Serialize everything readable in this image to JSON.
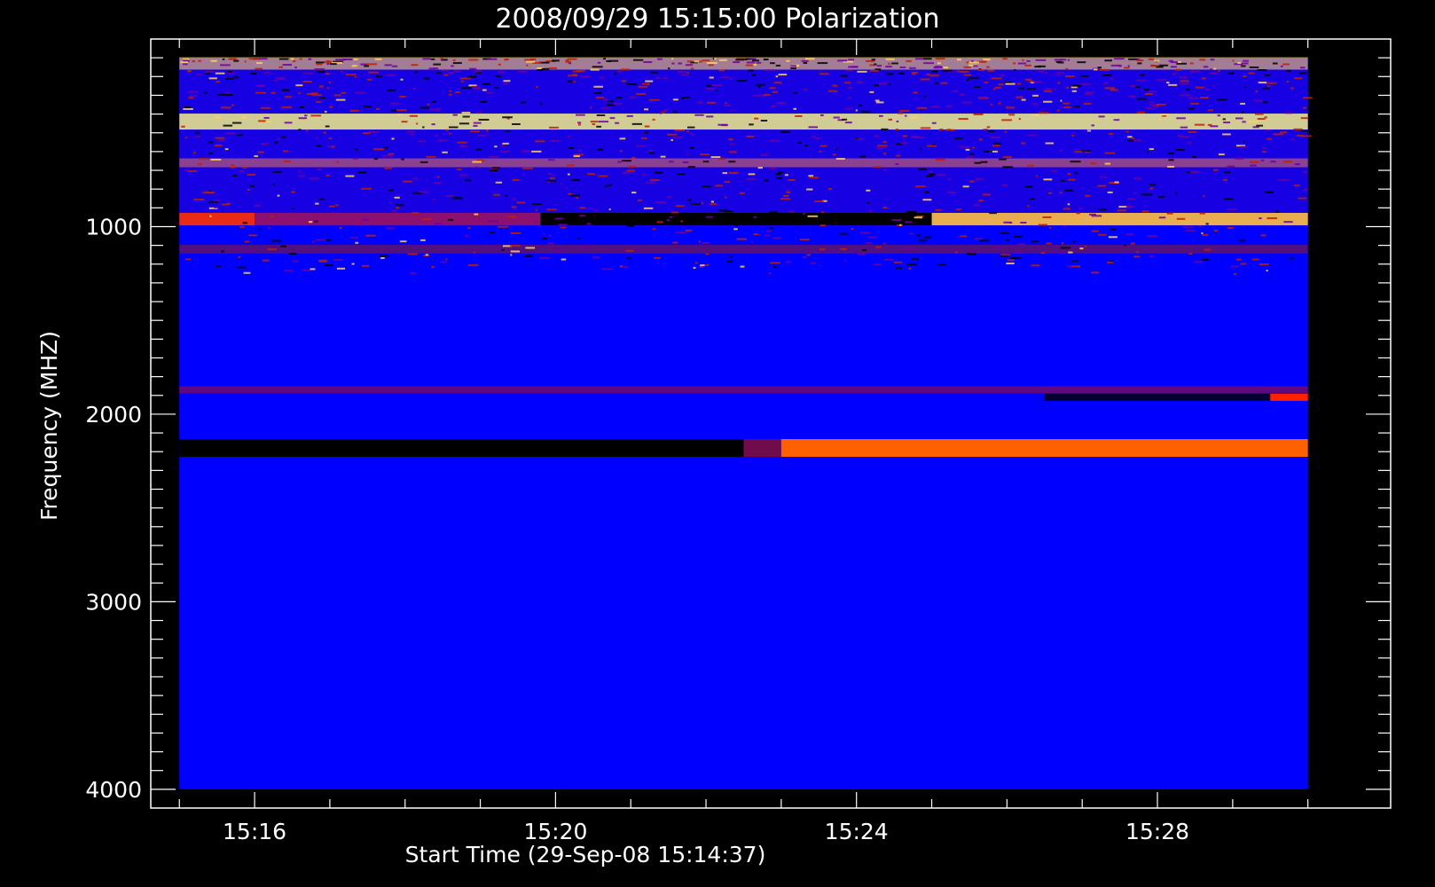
{
  "chart_data": {
    "type": "heatmap",
    "title": "2008/09/29 15:15:00 Polarization",
    "xlabel": "Start Time (29-Sep-08 15:14:37)",
    "ylabel": "Frequency (MHZ)",
    "x_ticks": [
      "15:16",
      "15:20",
      "15:24",
      "15:28"
    ],
    "x_tick_minutes": [
      16,
      20,
      24,
      28
    ],
    "xlim_minutes": [
      14.62,
      31.1
    ],
    "data_x_range_minutes": [
      15.0,
      30.0
    ],
    "y_ticks": [
      1000,
      2000,
      3000,
      4000
    ],
    "ylim": [
      4100,
      0
    ],
    "data_y_range": [
      100,
      4000
    ],
    "y_reversed": true,
    "colors": {
      "background": "#0000ff",
      "low": "#000000",
      "high": "#ff2000",
      "peak": "#ffff80",
      "frame": "#ffffff"
    },
    "bands": [
      {
        "freq": 130,
        "width": 14,
        "start_min": 15.0,
        "end_min": 30.0,
        "color": "#ffd060",
        "intensity": 0.6
      },
      {
        "freq": 440,
        "width": 18,
        "start_min": 15.0,
        "end_min": 30.0,
        "color": "#ffff80",
        "intensity": 0.8
      },
      {
        "freq": 660,
        "width": 10,
        "start_min": 15.0,
        "end_min": 30.0,
        "color": "#ff8040",
        "intensity": 0.5
      },
      {
        "freq": 960,
        "width": 14,
        "start_min": 15.0,
        "end_min": 16.0,
        "color": "#ff3000",
        "intensity": 0.9
      },
      {
        "freq": 960,
        "width": 14,
        "start_min": 16.0,
        "end_min": 19.8,
        "color": "#ff2000",
        "intensity": 0.5
      },
      {
        "freq": 960,
        "width": 14,
        "start_min": 19.8,
        "end_min": 25.0,
        "color": "#000000",
        "intensity": 1.0
      },
      {
        "freq": 960,
        "width": 14,
        "start_min": 25.0,
        "end_min": 30.0,
        "color": "#ffc040",
        "intensity": 0.9
      },
      {
        "freq": 1120,
        "width": 10,
        "start_min": 15.0,
        "end_min": 30.0,
        "color": "#a02000",
        "intensity": 0.5
      },
      {
        "freq": 1870,
        "width": 8,
        "start_min": 15.0,
        "end_min": 30.0,
        "color": "#c01000",
        "intensity": 0.5
      },
      {
        "freq": 1910,
        "width": 8,
        "start_min": 26.5,
        "end_min": 29.5,
        "color": "#000000",
        "intensity": 0.8
      },
      {
        "freq": 1910,
        "width": 8,
        "start_min": 29.5,
        "end_min": 30.0,
        "color": "#ff2000",
        "intensity": 1.0
      },
      {
        "freq": 2180,
        "width": 20,
        "start_min": 15.0,
        "end_min": 22.5,
        "color": "#000000",
        "intensity": 1.0
      },
      {
        "freq": 2180,
        "width": 20,
        "start_min": 22.5,
        "end_min": 23.0,
        "color": "#a01000",
        "intensity": 0.7
      },
      {
        "freq": 2180,
        "width": 20,
        "start_min": 23.0,
        "end_min": 30.0,
        "color": "#ff6000",
        "intensity": 1.0
      }
    ]
  }
}
